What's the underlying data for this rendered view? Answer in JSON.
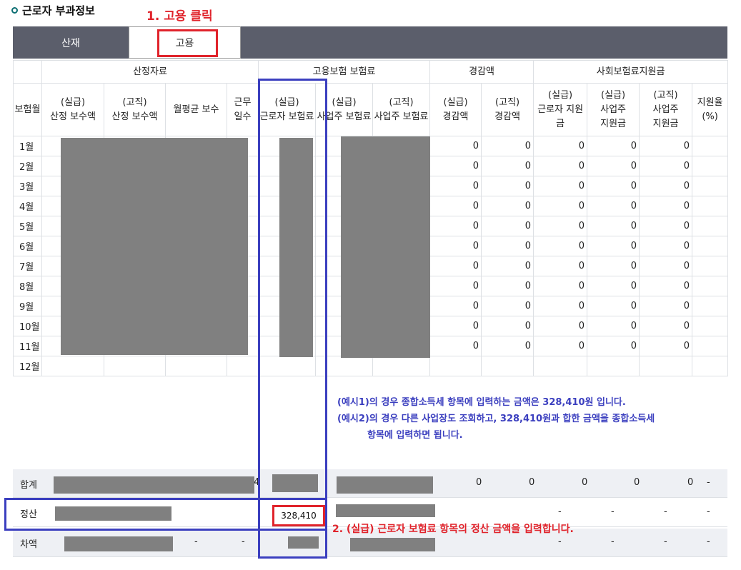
{
  "section": {
    "title": "근로자 부과정보"
  },
  "annotations": {
    "step1": "1. 고용 클릭",
    "step2": "2. (실급) 근로자 보험료 항목의 정산 금액을 입력합니다."
  },
  "tabs": [
    {
      "label": "산재",
      "active": false
    },
    {
      "label": "고용",
      "active": true
    }
  ],
  "table": {
    "groups": [
      "산정자료",
      "고용보험 보험료",
      "경감액",
      "사회보험료지원금"
    ],
    "columns": [
      [
        "보험월"
      ],
      [
        "(실급)",
        "산정 보수액"
      ],
      [
        "(고직)",
        "산정 보수액"
      ],
      [
        "월평균 보수"
      ],
      [
        "근무",
        "일수"
      ],
      [
        "(실급)",
        "근로자 보험료"
      ],
      [
        "(실급)",
        "사업주 보험료"
      ],
      [
        "(고직)",
        "사업주 보험료"
      ],
      [
        "(실급)",
        "경감액"
      ],
      [
        "(고직)",
        "경감액"
      ],
      [
        "(실급)",
        "근로자 지원금"
      ],
      [
        "(실급)",
        "사업주",
        "지원금"
      ],
      [
        "(고직)",
        "사업주",
        "지원금"
      ],
      [
        "지원율",
        "(%)"
      ]
    ],
    "months": [
      "1월",
      "2월",
      "3월",
      "4월",
      "5월",
      "6월",
      "7월",
      "8월",
      "9월",
      "10월",
      "11월",
      "12월"
    ],
    "zero": "0"
  },
  "notes": {
    "line1": "(예시1)의 경우 종합소득세 항목에 입력하는 금액은 328,410원 입니다.",
    "line2": "(예시2)의 경우 다른 사업장도 조회하고, 328,410원과 합한 금액을 종합소득세",
    "line3": "항목에 입력하면 됩니다."
  },
  "summary": {
    "total": {
      "label": "합계",
      "partial": "4",
      "values": [
        "0",
        "0",
        "0",
        "0",
        "0"
      ],
      "dash": "-"
    },
    "settle": {
      "label": "정산",
      "value": "328,410",
      "dashes": [
        "-",
        "-",
        "-",
        "-"
      ]
    },
    "diff": {
      "label": "차액",
      "dashes_left": [
        "-",
        "-"
      ],
      "dashes_right": [
        "-",
        "-",
        "-",
        "-"
      ]
    }
  },
  "colors": {
    "accent_red": "#e0232b",
    "accent_blue": "#3b3fbf",
    "tab_bar": "#5b5e6b",
    "redacted": "#808080"
  }
}
